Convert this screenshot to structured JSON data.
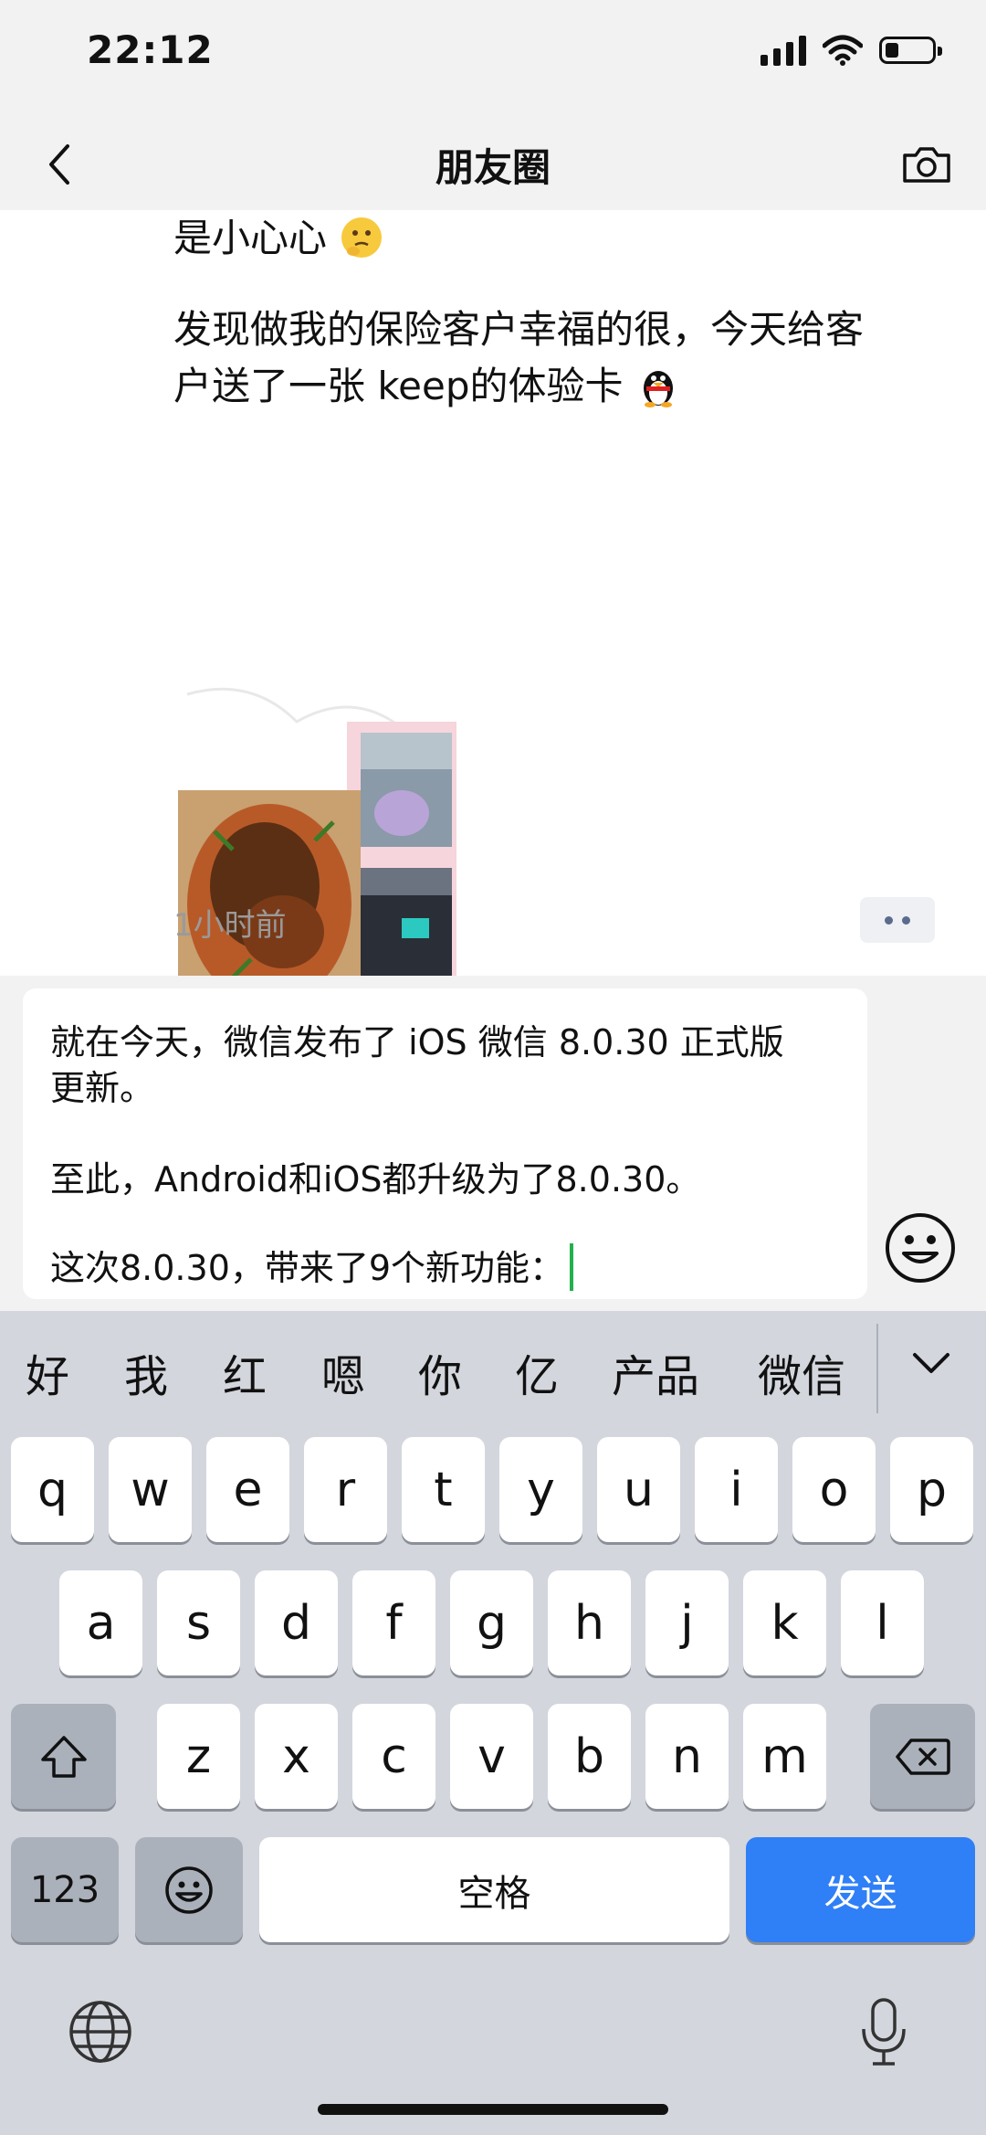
{
  "status_bar": {
    "time": "22:12"
  },
  "nav": {
    "title": "朋友圈"
  },
  "post": {
    "text_line1": "是小心心",
    "text_line2": "发现做我的保险客户幸福的很，今天给客",
    "text_line3": "户送了一张 keep的体验卡",
    "time": "1小时前"
  },
  "compose": {
    "line1": "就在今天，微信发布了 iOS 微信 8.0.30 正式版",
    "line2": "更新。",
    "line3": "至此，Android和iOS都升级为了8.0.30。",
    "line4": "这次8.0.30，带来了9个新功能："
  },
  "keyboard": {
    "candidates": [
      "好",
      "我",
      "红",
      "嗯",
      "你",
      "亿",
      "产品",
      "微信"
    ],
    "row1": [
      "q",
      "w",
      "e",
      "r",
      "t",
      "y",
      "u",
      "i",
      "o",
      "p"
    ],
    "row2": [
      "a",
      "s",
      "d",
      "f",
      "g",
      "h",
      "j",
      "k",
      "l"
    ],
    "row3": [
      "z",
      "x",
      "c",
      "v",
      "b",
      "n",
      "m"
    ],
    "numbers_label": "123",
    "space_label": "空格",
    "send_label": "发送"
  },
  "icons": [
    "back-arrow-icon",
    "camera-icon",
    "emoji-icon",
    "shift-icon",
    "delete-icon",
    "globe-icon",
    "microphone-icon",
    "chevron-down-icon"
  ],
  "colors": {
    "send_key": "#2f7ff6",
    "caret": "#22b14c",
    "keyboard_bg": "#d3d6dd"
  }
}
